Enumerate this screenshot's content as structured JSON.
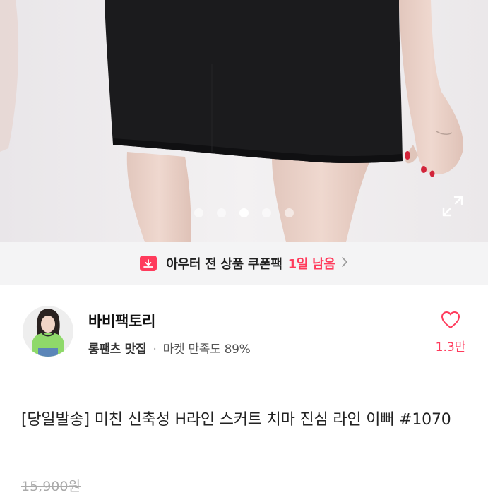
{
  "photo": {
    "image_description": "product photo: model wearing black knit mini skirt",
    "slide_count": 5,
    "active_slide": 3,
    "expand_icon": "expand-icon"
  },
  "coupon": {
    "icon": "coupon-ticket-icon",
    "text": "아우터 전 상품 쿠폰팩",
    "remaining": "1일 남음",
    "chevron_icon": "chevron-right-icon"
  },
  "shop": {
    "name": "바비팩토리",
    "tag": "롱팬츠 맛집",
    "separator": "·",
    "satisfaction": "마켓 만족도 89%",
    "like_count": "1.3만",
    "like_icon": "heart-outline-icon"
  },
  "product": {
    "title": "[당일발송] 미친 신축성 H라인 스커트 치마 진심 라인 이뻐 #1070",
    "original_price": "15,900원"
  },
  "colors": {
    "accent": "#ff3b5c",
    "banner_bg": "#f4f4f5",
    "text": "#222222",
    "muted": "#aaaaaa"
  }
}
